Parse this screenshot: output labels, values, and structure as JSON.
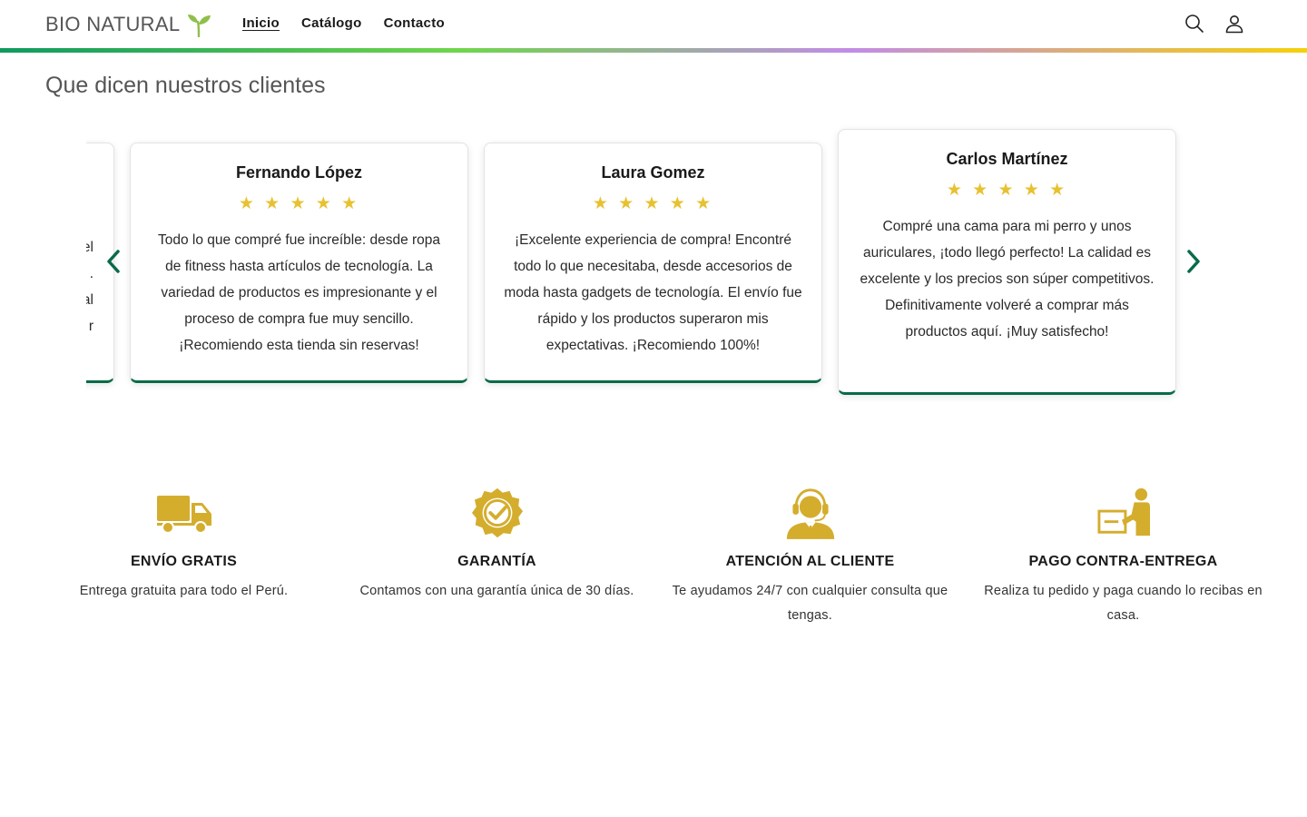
{
  "brand": {
    "name": "BIO NATURAL",
    "icon": "sprout-icon",
    "icon_color": "#8fbf4a"
  },
  "nav": {
    "items": [
      {
        "label": "Inicio",
        "active": true
      },
      {
        "label": "Catálogo",
        "active": false
      },
      {
        "label": "Contacto",
        "active": false
      }
    ]
  },
  "header_icons": {
    "search": "search-icon",
    "account": "user-icon"
  },
  "testimonials": {
    "title": "Que dicen nuestros clientes",
    "partial_lines": [
      "el",
      ".",
      "al",
      "r"
    ],
    "cards": [
      {
        "name": "Fernando López",
        "stars": "★ ★ ★ ★ ★",
        "text": "Todo lo que compré fue increíble: desde ropa de fitness hasta artículos de tecnología. La variedad de productos es impresionante y el proceso de compra fue muy sencillo. ¡Recomiendo esta tienda sin reservas!"
      },
      {
        "name": "Laura Gomez",
        "stars": "★ ★ ★ ★ ★",
        "text": "¡Excelente experiencia de compra! Encontré todo lo que necesitaba, desde accesorios de moda hasta gadgets de tecnología. El envío fue rápido y los productos superaron mis expectativas. ¡Recomiendo 100%!"
      },
      {
        "name": "Carlos Martínez",
        "stars": "★ ★ ★ ★ ★",
        "text": "Compré una cama para mi perro y unos auriculares, ¡todo llegó perfecto! La calidad es excelente y los precios son súper competitivos. Definitivamente volveré a comprar más productos aquí. ¡Muy satisfecho!"
      }
    ],
    "accent_color": "#0a6b47",
    "star_color": "#e8c131"
  },
  "features": {
    "icon_color": "#d4ad2d",
    "items": [
      {
        "icon": "truck-icon",
        "title": "ENVÍO GRATIS",
        "desc": "Entrega gratuita para todo el Perú."
      },
      {
        "icon": "badge-check-icon",
        "title": "GARANTÍA",
        "desc": "Contamos con una garantía única de 30 días."
      },
      {
        "icon": "headset-agent-icon",
        "title": "ATENCIÓN AL CLIENTE",
        "desc": "Te ayudamos 24/7 con cualquier consulta que tengas."
      },
      {
        "icon": "delivery-person-icon",
        "title": "PAGO CONTRA-ENTREGA",
        "desc": "Realiza tu pedido y paga cuando lo recibas en casa."
      }
    ]
  }
}
